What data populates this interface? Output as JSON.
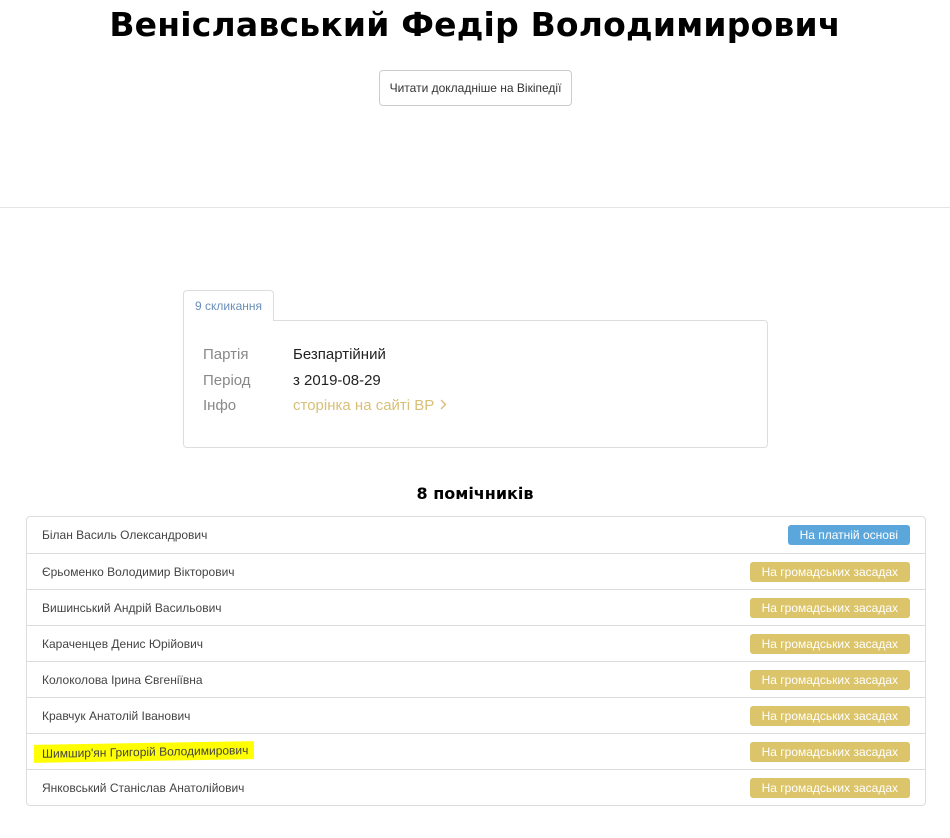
{
  "header": {
    "title": "Веніславський Федір Володимирович",
    "wiki_button_label": "Читати докладніше на Вікіпедії"
  },
  "tabs": [
    {
      "label": "9 скликання",
      "active": true
    }
  ],
  "info": {
    "party_key": "Партія",
    "party_value": "Безпартійний",
    "period_key": "Період",
    "period_value": "з 2019-08-29",
    "info_key": "Інфо",
    "info_link": "сторінка на сайті ВР",
    "info_link_icon": "chevron-right-icon"
  },
  "assistants": {
    "heading": "8 помічників",
    "items": [
      {
        "name": "Білан Василь Олександрович",
        "status": "На платній основі",
        "status_type": "paid"
      },
      {
        "name": "Єрьоменко Володимир Вікторович",
        "status": "На громадських засадах",
        "status_type": "volunteer"
      },
      {
        "name": "Вишинський Андрій Васильович",
        "status": "На громадських засадах",
        "status_type": "volunteer"
      },
      {
        "name": "Караченцев Денис Юрійович",
        "status": "На громадських засадах",
        "status_type": "volunteer"
      },
      {
        "name": "Колоколова Ірина Євгеніївна",
        "status": "На громадських засадах",
        "status_type": "volunteer"
      },
      {
        "name": "Кравчук Анатолій Іванович",
        "status": "На громадських засадах",
        "status_type": "volunteer"
      },
      {
        "name": "Шимшир'ян Григорій Володимирович",
        "status": "На громадських засадах",
        "status_type": "volunteer",
        "highlighted": true
      },
      {
        "name": "Янковський Станіслав Анатолійович",
        "status": "На громадських засадах",
        "status_type": "volunteer"
      }
    ]
  },
  "colors": {
    "paid_badge": "#5ba7dc",
    "volunteer_badge": "#dcc46a",
    "link": "#d8bf78",
    "tab_text": "#6b8fb8",
    "highlight": "#ffff00"
  }
}
